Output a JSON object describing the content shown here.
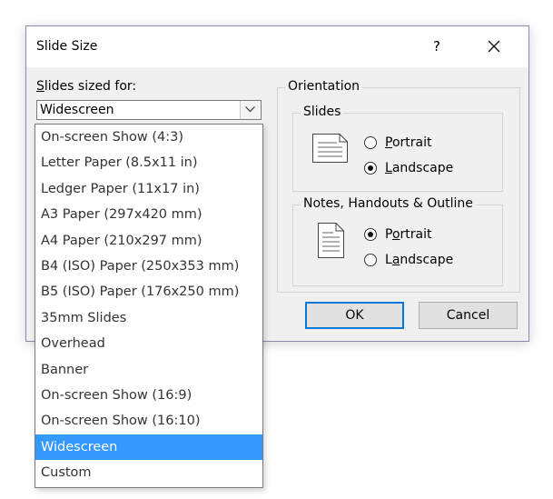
{
  "dialog": {
    "title": "Slide Size",
    "help": "?",
    "slides_sized_for_label": {
      "pre": "",
      "key": "S",
      "post": "lides sized for:"
    },
    "combo_value": "Widescreen",
    "orientation_label": "Orientation",
    "slides_group_label": "Slides",
    "slides_portrait": {
      "key": "P",
      "post": "ortrait"
    },
    "slides_landscape": {
      "key": "L",
      "post": "andscape"
    },
    "notes_group_label": "Notes, Handouts & Outline",
    "notes_portrait": {
      "pre": "P",
      "key": "o",
      "post": "rtrait"
    },
    "notes_landscape": {
      "pre": "L",
      "key": "a",
      "post": "ndscape"
    },
    "ok_label": "OK",
    "cancel_label": "Cancel"
  },
  "dropdown": {
    "selected": "Widescreen",
    "items": [
      "On-screen Show (4:3)",
      "Letter Paper (8.5x11 in)",
      "Ledger Paper (11x17 in)",
      "A3 Paper (297x420 mm)",
      "A4 Paper (210x297 mm)",
      "B4 (ISO) Paper (250x353 mm)",
      "B5 (ISO) Paper (176x250 mm)",
      "35mm Slides",
      "Overhead",
      "Banner",
      "On-screen Show (16:9)",
      "On-screen Show (16:10)",
      "Widescreen",
      "Custom"
    ]
  },
  "state": {
    "slides_orientation": "Landscape",
    "notes_orientation": "Portrait"
  },
  "colors": {
    "selection": "#3399ff",
    "default_button_border": "#0078d7",
    "dialog_bg": "#f0f0f0"
  }
}
